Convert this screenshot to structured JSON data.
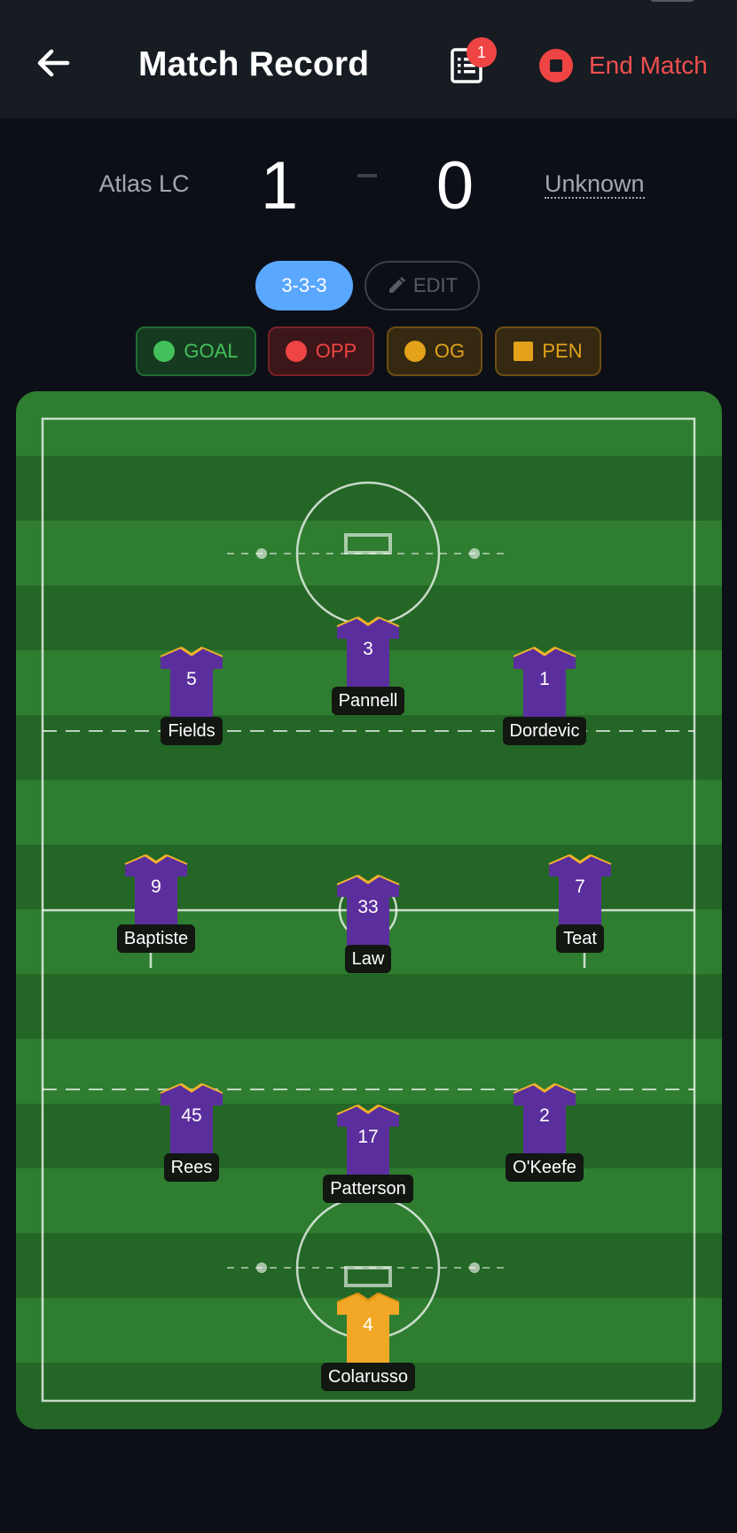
{
  "header": {
    "title": "Match Record",
    "notification_count": "1",
    "end_label": "End Match"
  },
  "score": {
    "home_team": "Atlas LC",
    "home_goals": "1",
    "away_goals": "0",
    "away_team": "Unknown"
  },
  "controls": {
    "formation": "3-3-3",
    "edit_label": "EDIT"
  },
  "event_chips": [
    {
      "label": "GOAL",
      "color": "#43c05a"
    },
    {
      "label": "OPP",
      "color": "#ef4444"
    },
    {
      "label": "OG",
      "color": "#e3a21a"
    },
    {
      "label": "PEN",
      "color": "#e3a21a"
    }
  ],
  "colors": {
    "pitch_light": "#2f7d30",
    "pitch_dark": "#246625",
    "shirt": "#5b2e9d",
    "shirt_trim": "#f2b22c",
    "keeper_shirt": "#f2a826",
    "accent_blue": "#5aa7ff",
    "danger": "#ef4444"
  },
  "players": [
    {
      "number": "3",
      "name": "Pannell"
    },
    {
      "number": "5",
      "name": "Fields"
    },
    {
      "number": "1",
      "name": "Dordevic"
    },
    {
      "number": "9",
      "name": "Baptiste"
    },
    {
      "number": "33",
      "name": "Law"
    },
    {
      "number": "7",
      "name": "Teat"
    },
    {
      "number": "45",
      "name": "Rees"
    },
    {
      "number": "17",
      "name": "Patterson"
    },
    {
      "number": "2",
      "name": "O'Keefe"
    },
    {
      "number": "4",
      "name": "Colarusso",
      "goalkeeper": true
    }
  ]
}
